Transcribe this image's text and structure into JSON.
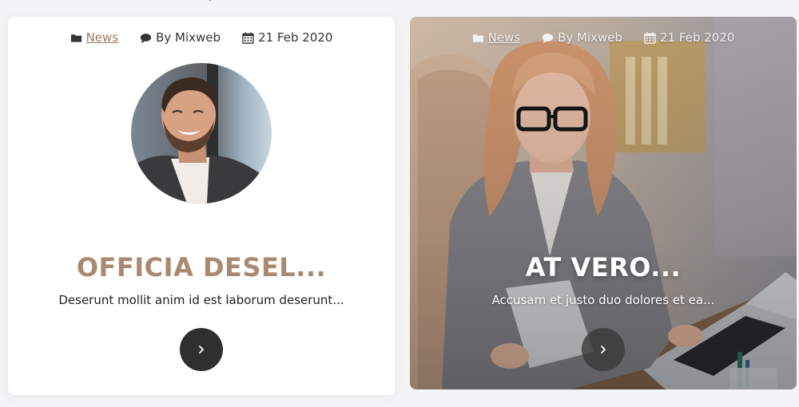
{
  "cards": [
    {
      "category": "News",
      "author": "By Mixweb",
      "date": "21 Feb 2020",
      "title": "OFFICIA DESEL...",
      "excerpt": "Deserunt mollit anim id est laborum deserunt..."
    },
    {
      "category": "News",
      "author": "By Mixweb",
      "date": "21 Feb 2020",
      "title": "AT VERO...",
      "excerpt": "Accusam et justo duo dolores et ea..."
    }
  ],
  "colors": {
    "accent": "#a98a70",
    "link": "#9c7a60",
    "button": "#2f2f2f",
    "background": "#f4f4f6"
  },
  "icons": {
    "category": "folder-icon",
    "author": "comment-icon",
    "date": "calendar-icon",
    "button": "chevron-right-icon"
  }
}
